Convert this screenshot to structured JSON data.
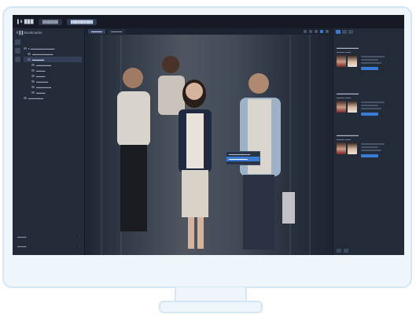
{
  "topbar": {
    "logo": "▌Ⅱ ███",
    "tabs": [
      "███████",
      "██████████"
    ]
  },
  "sidebar": {
    "title": "Ⅱ ▌▌Bookmarks",
    "tree": [
      {
        "label": "▸ ▬▬▬▬▬▬▬▬",
        "level": 0
      },
      {
        "label": "▬▬▬▬▬▬▬",
        "level": 1
      },
      {
        "label": "▬▬▬▬",
        "level": 1
      },
      {
        "label": "▬▬▬▬▬",
        "level": 2
      },
      {
        "label": "▬▬▬",
        "level": 2
      },
      {
        "label": "▬▬▬",
        "level": 2
      },
      {
        "label": "▬▬▬▬",
        "level": 2
      },
      {
        "label": "▬▬▬▬▬",
        "level": 2
      },
      {
        "label": "▬▬▬",
        "level": 2
      },
      {
        "label": "▬▬▬▬▬",
        "level": 0
      }
    ],
    "footer1": "▬▬▬",
    "footer2": "▬▬▬"
  },
  "viewer": {
    "tabs": [
      "▬▬▬▬",
      "▬▬▬▬"
    ],
    "popup_items": [
      "▬▬▬▬▬▬▬▬",
      "▬▬▬▬▬▬▬"
    ]
  },
  "right_panel": {
    "cards": [
      {
        "title": "▬▬▬▬▬▬▬",
        "sub": "▬▬▬ ▬▬"
      },
      {
        "title": "▬▬▬▬▬▬▬",
        "sub": "▬▬▬ ▬▬"
      },
      {
        "title": "▬▬▬▬▬▬▬",
        "sub": "▬▬▬ ▬▬"
      }
    ]
  },
  "colors": {
    "accent": "#3a7bd5",
    "alert": "#e03b3b",
    "app_bg": "#1f2532",
    "monitor_frame": "#eef6fc"
  }
}
